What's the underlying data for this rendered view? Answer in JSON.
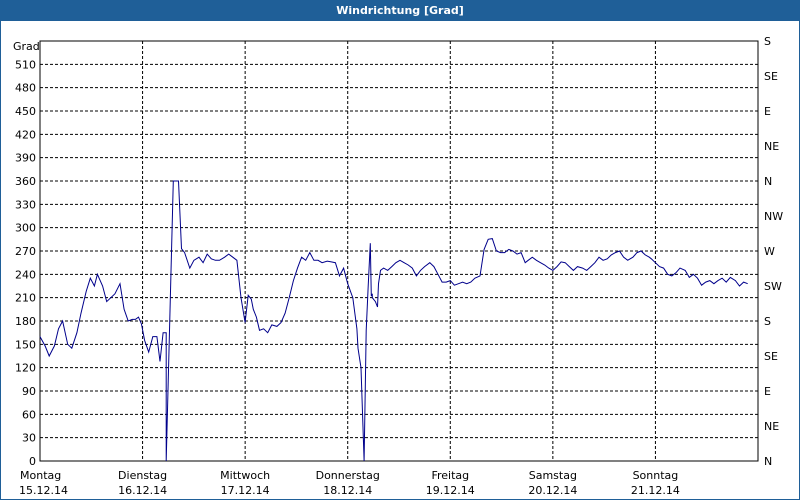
{
  "window": {
    "title": "Windrichtung [Grad]"
  },
  "chart_data": {
    "type": "line",
    "ylabel": "Grad",
    "ylim": [
      0,
      540
    ],
    "y_ticks": [
      0,
      30,
      60,
      90,
      120,
      150,
      180,
      210,
      240,
      270,
      300,
      330,
      360,
      390,
      420,
      450,
      480,
      510
    ],
    "right_ticks": [
      {
        "value": 0,
        "label": "N"
      },
      {
        "value": 45,
        "label": "NE"
      },
      {
        "value": 90,
        "label": "E"
      },
      {
        "value": 135,
        "label": "SE"
      },
      {
        "value": 180,
        "label": "S"
      },
      {
        "value": 225,
        "label": "SW"
      },
      {
        "value": 270,
        "label": "W"
      },
      {
        "value": 315,
        "label": "NW"
      },
      {
        "value": 360,
        "label": "N"
      },
      {
        "value": 405,
        "label": "NE"
      },
      {
        "value": 450,
        "label": "E"
      },
      {
        "value": 495,
        "label": "SE"
      },
      {
        "value": 540,
        "label": "S"
      }
    ],
    "xlim": [
      0,
      7
    ],
    "x_ticks": [
      {
        "day": "Montag",
        "date": "15.12.14"
      },
      {
        "day": "Dienstag",
        "date": "16.12.14"
      },
      {
        "day": "Mittwoch",
        "date": "17.12.14"
      },
      {
        "day": "Donnerstag",
        "date": "18.12.14"
      },
      {
        "day": "Freitag",
        "date": "19.12.14"
      },
      {
        "day": "Samstag",
        "date": "20.12.14"
      },
      {
        "day": "Sonntag",
        "date": "21.12.14"
      }
    ],
    "grid": true,
    "color": "#00008b",
    "series": [
      {
        "x": [
          0.0,
          0.05,
          0.09,
          0.14,
          0.18,
          0.22,
          0.27,
          0.31,
          0.36,
          0.4,
          0.45,
          0.49,
          0.53,
          0.56,
          0.61,
          0.65,
          0.69,
          0.73,
          0.78,
          0.82,
          0.86,
          0.9,
          0.93,
          0.96,
          0.99,
          1.02,
          1.06,
          1.1,
          1.14,
          1.17,
          1.2,
          1.23,
          1.23,
          1.3,
          1.32,
          1.35,
          1.38,
          1.41,
          1.46,
          1.5,
          1.55,
          1.59,
          1.63,
          1.67,
          1.71,
          1.75,
          1.8,
          1.84,
          1.88,
          1.92,
          1.96,
          2.0,
          2.03,
          2.06,
          2.08,
          2.11,
          2.14,
          2.18,
          2.22,
          2.26,
          2.31,
          2.35,
          2.39,
          2.43,
          2.47,
          2.51,
          2.55,
          2.59,
          2.63,
          2.67,
          2.71,
          2.75,
          2.8,
          2.84,
          2.88,
          2.92,
          2.96,
          3.0,
          3.05,
          3.09,
          3.1,
          3.13,
          3.16,
          3.18,
          3.2,
          3.22,
          3.23,
          3.24,
          3.24,
          3.27,
          3.29,
          3.3,
          3.32,
          3.35,
          3.39,
          3.43,
          3.47,
          3.51,
          3.55,
          3.59,
          3.63,
          3.67,
          3.71,
          3.75,
          3.8,
          3.84,
          3.88,
          3.92,
          3.96,
          4.0,
          4.04,
          4.08,
          4.12,
          4.16,
          4.2,
          4.24,
          4.29,
          4.33,
          4.37,
          4.41,
          4.45,
          4.49,
          4.53,
          4.57,
          4.61,
          4.65,
          4.69,
          4.73,
          4.76,
          4.8,
          4.84,
          4.88,
          4.92,
          4.96,
          5.0,
          5.04,
          5.08,
          5.12,
          5.16,
          5.2,
          5.24,
          5.29,
          5.33,
          5.37,
          5.41,
          5.45,
          5.49,
          5.53,
          5.57,
          5.61,
          5.65,
          5.69,
          5.73,
          5.78,
          5.82,
          5.86,
          5.9,
          5.94,
          5.96,
          6.0,
          6.04,
          6.08,
          6.12,
          6.16,
          6.2,
          6.24,
          6.29,
          6.33,
          6.37,
          6.41,
          6.45,
          6.49,
          6.53,
          6.57,
          6.61,
          6.65,
          6.69,
          6.73,
          6.78,
          6.82,
          6.86,
          6.9
        ],
        "y": [
          160,
          148,
          135,
          148,
          170,
          180,
          150,
          145,
          165,
          190,
          218,
          235,
          225,
          240,
          225,
          205,
          210,
          215,
          228,
          195,
          180,
          182,
          182,
          185,
          176,
          155,
          140,
          160,
          160,
          128,
          165,
          165,
          0,
          360,
          360,
          360,
          273,
          268,
          248,
          258,
          262,
          255,
          266,
          260,
          258,
          258,
          262,
          266,
          262,
          258,
          210,
          178,
          213,
          208,
          195,
          185,
          168,
          170,
          165,
          175,
          173,
          178,
          190,
          210,
          232,
          248,
          262,
          258,
          268,
          258,
          258,
          255,
          257,
          256,
          255,
          238,
          248,
          228,
          210,
          170,
          145,
          120,
          0,
          168,
          225,
          280,
          212,
          215,
          210,
          205,
          198,
          228,
          245,
          248,
          245,
          250,
          255,
          258,
          255,
          252,
          248,
          238,
          245,
          250,
          255,
          250,
          240,
          230,
          230,
          232,
          226,
          228,
          230,
          228,
          230,
          235,
          238,
          272,
          285,
          286,
          270,
          268,
          268,
          272,
          270,
          266,
          268,
          255,
          258,
          262,
          258,
          255,
          252,
          248,
          245,
          250,
          256,
          255,
          250,
          245,
          250,
          248,
          245,
          250,
          255,
          262,
          258,
          260,
          265,
          268,
          270,
          262,
          258,
          262,
          268,
          270,
          265,
          262,
          260,
          255,
          250,
          248,
          240,
          238,
          242,
          248,
          245,
          236,
          240,
          235,
          226,
          230,
          232,
          228,
          232,
          235,
          230,
          236,
          232,
          225,
          230,
          228
        ]
      }
    ]
  }
}
